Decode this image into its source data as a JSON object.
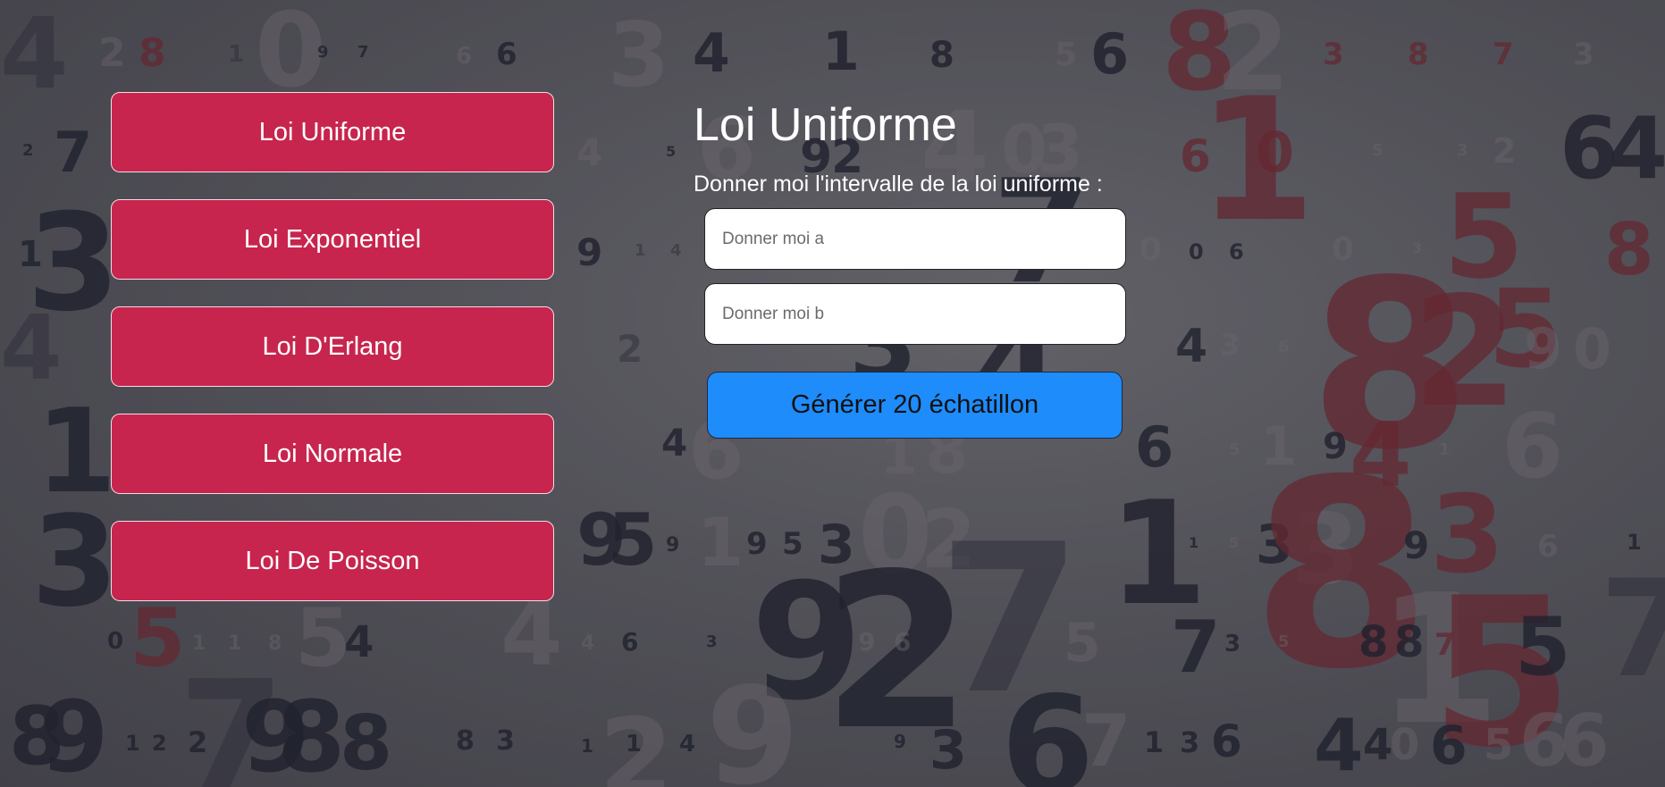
{
  "sidebar": {
    "items": [
      {
        "label": "Loi Uniforme"
      },
      {
        "label": "Loi Exponentiel"
      },
      {
        "label": "Loi D'Erlang"
      },
      {
        "label": "Loi Normale"
      },
      {
        "label": "Loi De Poisson"
      }
    ]
  },
  "main": {
    "title": "Loi Uniforme",
    "subtitle": "Donner moi l'intervalle de la loi uniforme :",
    "input_a": {
      "placeholder": "Donner moi a",
      "value": ""
    },
    "input_b": {
      "placeholder": "Donner moi b",
      "value": ""
    },
    "generate_label": "Générer 20 échatillon"
  },
  "colors": {
    "nav_button": "#c7254e",
    "generate_button": "#1e8cfb",
    "text": "#ffffff"
  }
}
